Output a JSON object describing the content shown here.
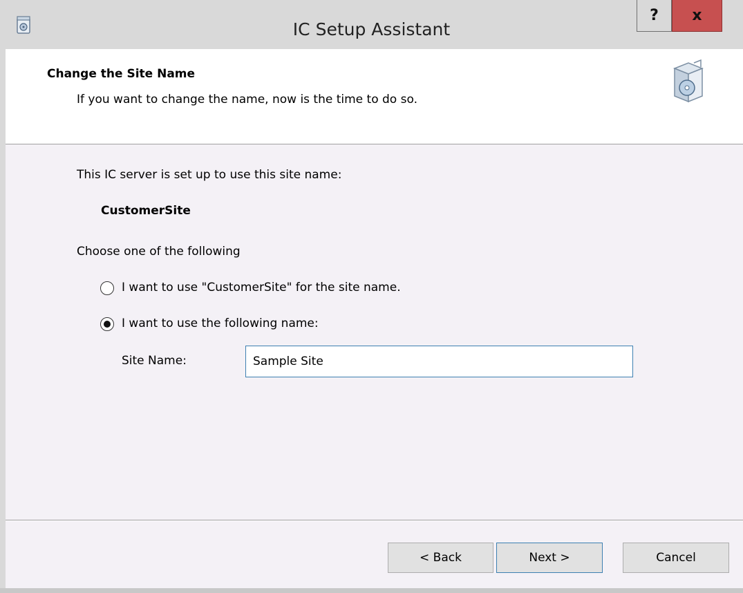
{
  "window": {
    "title": "IC Setup Assistant",
    "help_label": "?",
    "close_label": "x"
  },
  "header": {
    "title": "Change the Site Name",
    "subtitle": "If you want to change the name, now is the time to do so."
  },
  "content": {
    "intro": "This IC server is set up to use this site name:",
    "current_site": "CustomerSite",
    "choose_label": "Choose one of the following",
    "option_keep": "I want to use \"CustomerSite\" for the site name.",
    "option_custom": "I want to use the following name:",
    "selected_option": "custom",
    "site_name_label": "Site Name:",
    "site_name_value": "Sample Site"
  },
  "buttons": {
    "back": "< Back",
    "next": "Next >",
    "cancel": "Cancel"
  },
  "colors": {
    "close_button": "#c75050",
    "focus_border": "#3c7fb1"
  }
}
